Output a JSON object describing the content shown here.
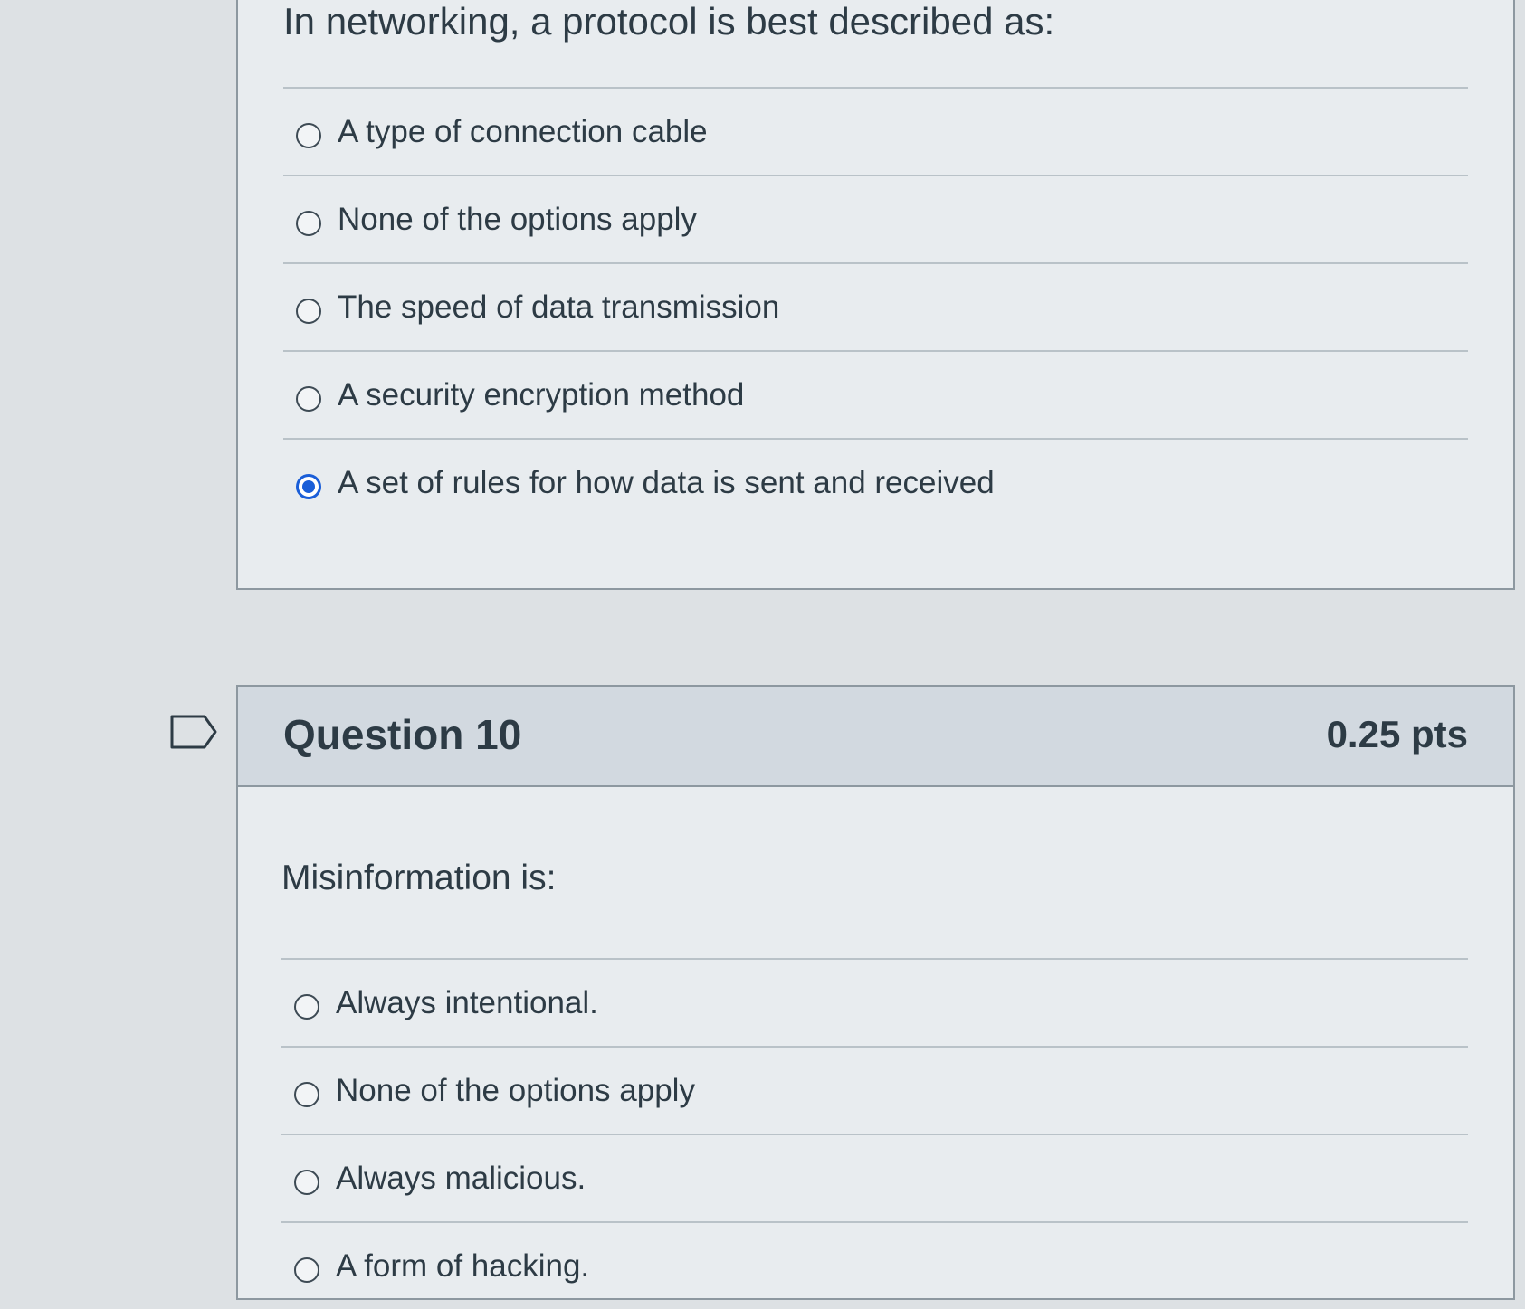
{
  "question9": {
    "text": "In networking, a protocol is best described as:",
    "answers": [
      {
        "label": "A type of connection cable",
        "selected": false
      },
      {
        "label": "None of the options apply",
        "selected": false
      },
      {
        "label": "The speed of data transmission",
        "selected": false
      },
      {
        "label": "A security encryption method",
        "selected": false
      },
      {
        "label": "A set of rules for how data is sent and received",
        "selected": true
      }
    ]
  },
  "question10": {
    "title": "Question 10",
    "points": "0.25 pts",
    "text": "Misinformation is:",
    "flag_icon": "flag-outline-icon",
    "answers": [
      {
        "label": "Always intentional.",
        "selected": false
      },
      {
        "label": "None of the options apply",
        "selected": false
      },
      {
        "label": "Always malicious.",
        "selected": false
      },
      {
        "label": "A form of hacking.",
        "selected": false
      }
    ]
  },
  "colors": {
    "selected_radio": "#1a5ed8",
    "text": "#2d3b45",
    "header_bg": "#d2d9e0",
    "card_bg": "#e8ecef"
  }
}
